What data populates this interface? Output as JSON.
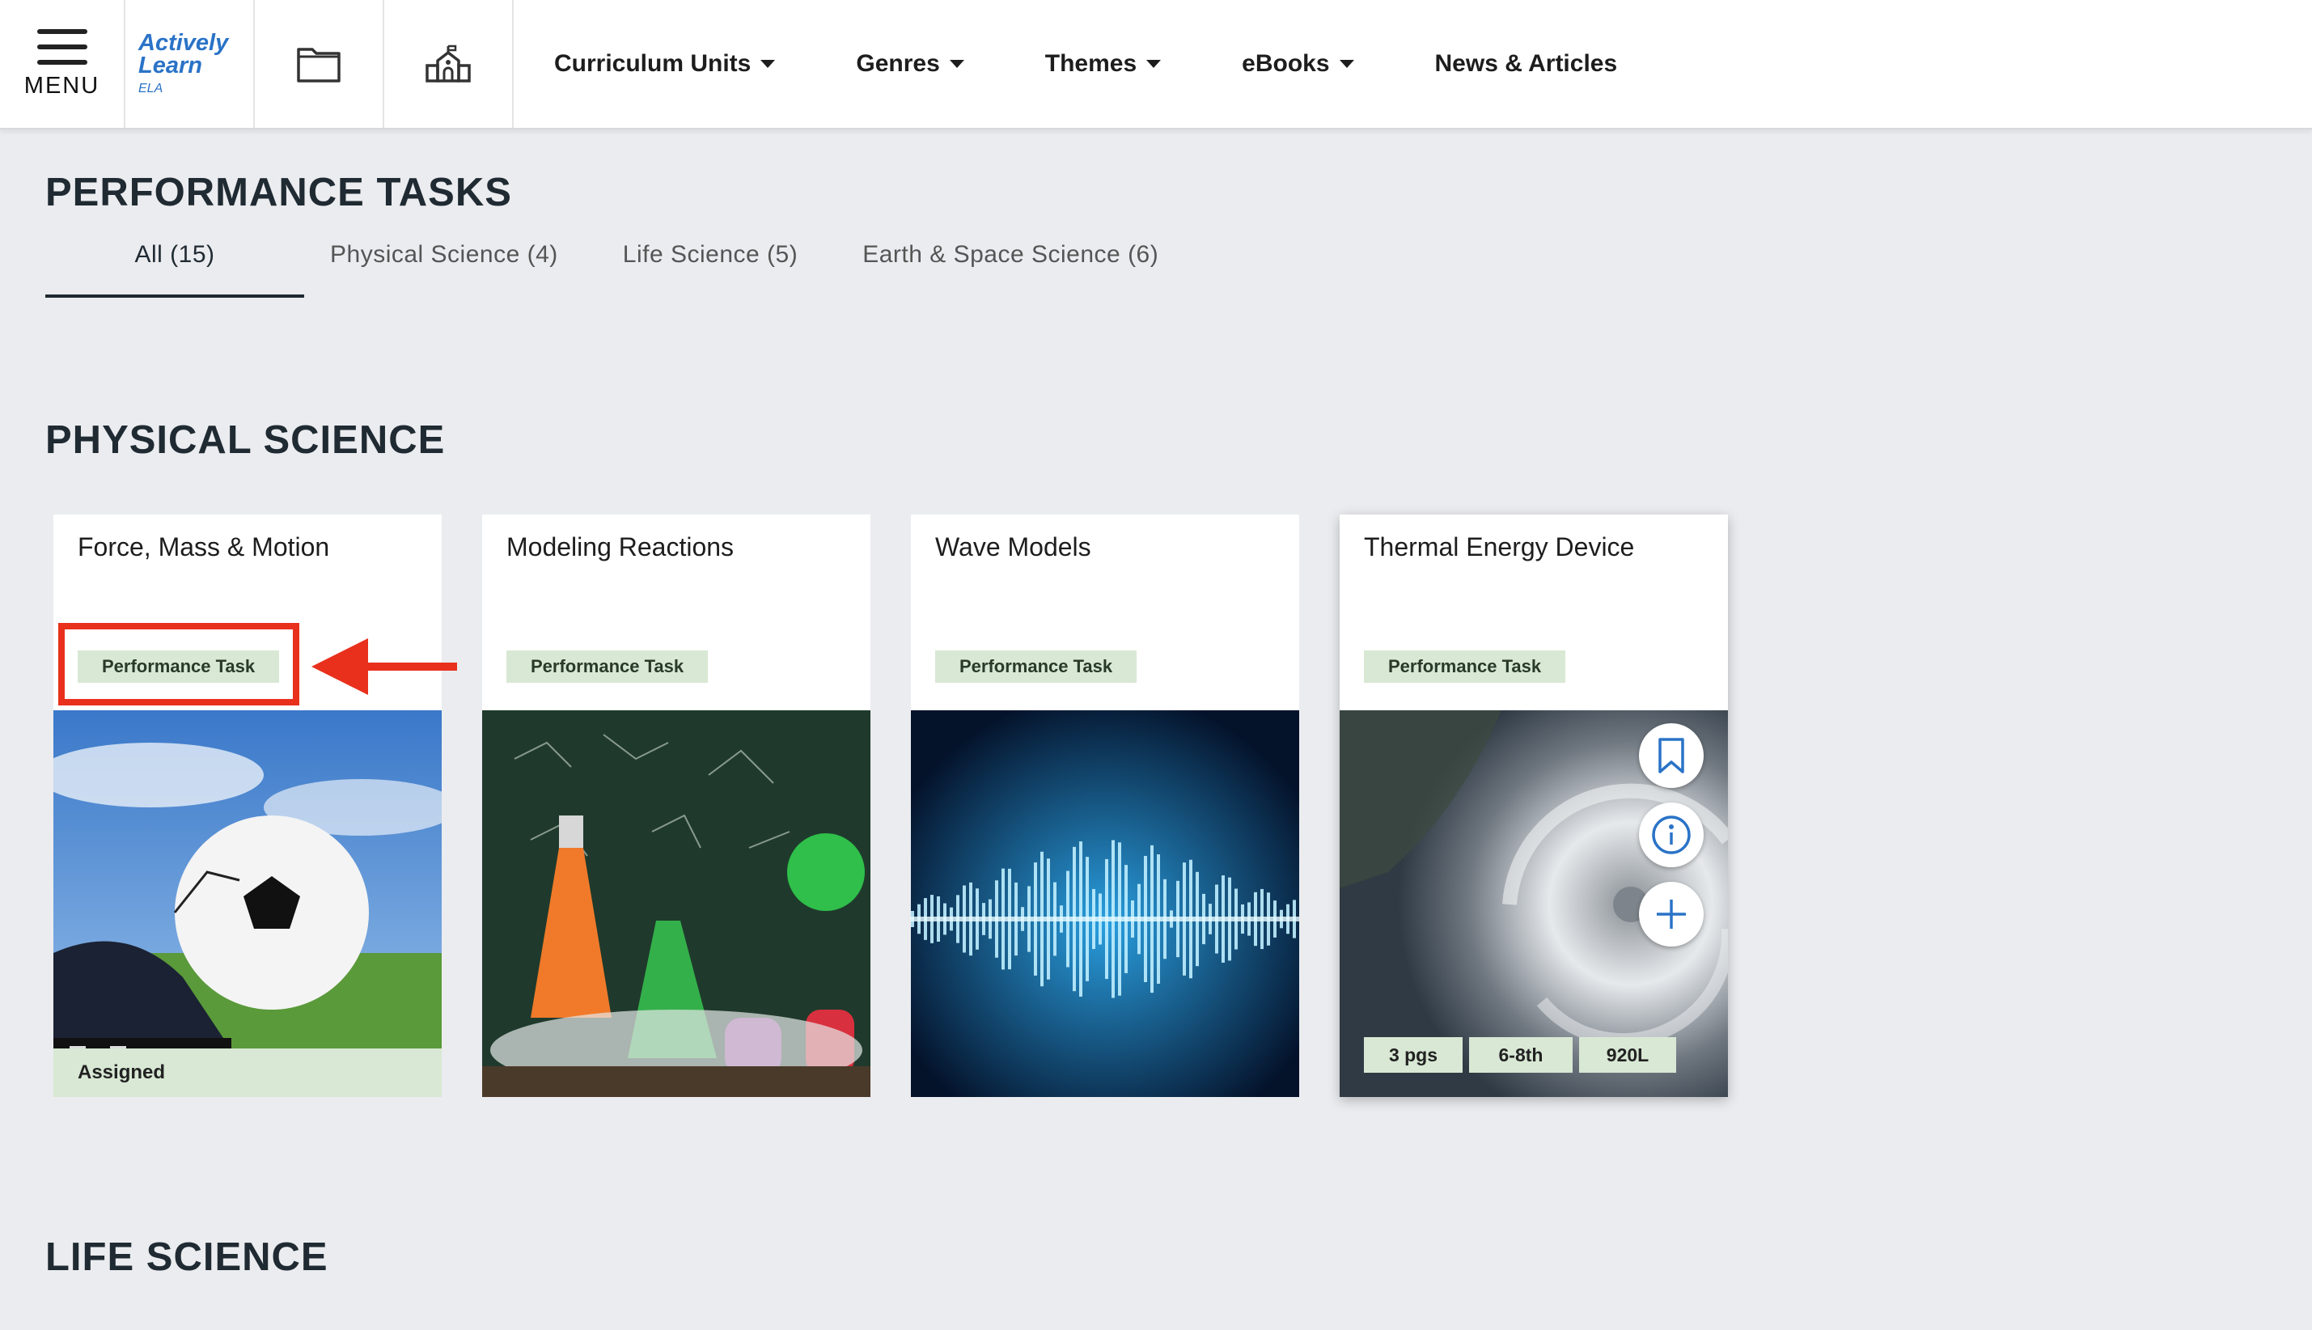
{
  "nav": {
    "menu_label": "MENU",
    "logo": {
      "line1": "Actively",
      "line2": "Learn",
      "line3": "ELA"
    },
    "links": [
      {
        "label": "Curriculum Units",
        "dropdown": true
      },
      {
        "label": "Genres",
        "dropdown": true
      },
      {
        "label": "Themes",
        "dropdown": true
      },
      {
        "label": "eBooks",
        "dropdown": true
      },
      {
        "label": "News & Articles",
        "dropdown": false
      }
    ]
  },
  "page": {
    "title": "PERFORMANCE TASKS",
    "tabs": [
      {
        "label": "All (15)",
        "active": true
      },
      {
        "label": "Physical Science (4)",
        "active": false
      },
      {
        "label": "Life Science (5)",
        "active": false
      },
      {
        "label": "Earth & Space Science (6)",
        "active": false
      }
    ]
  },
  "sections": {
    "physical": {
      "title": "PHYSICAL SCIENCE",
      "cards": [
        {
          "title": "Force, Mass & Motion",
          "badge": "Performance Task",
          "status": "Assigned",
          "image": "soccer-ball"
        },
        {
          "title": "Modeling Reactions",
          "badge": "Performance Task",
          "image": "chemistry-flasks"
        },
        {
          "title": "Wave Models",
          "badge": "Performance Task",
          "image": "sound-wave"
        },
        {
          "title": "Thermal Energy Device",
          "badge": "Performance Task",
          "image": "hurricane",
          "meta": {
            "pages": "3 pgs",
            "grades": "6-8th",
            "lexile": "920L"
          }
        }
      ]
    },
    "life": {
      "title": "LIFE SCIENCE"
    }
  },
  "colors": {
    "accent_blue": "#2a73c7",
    "badge_green": "#d8e8d4",
    "annotation_red": "#e8301c",
    "page_bg": "#ebecef"
  }
}
